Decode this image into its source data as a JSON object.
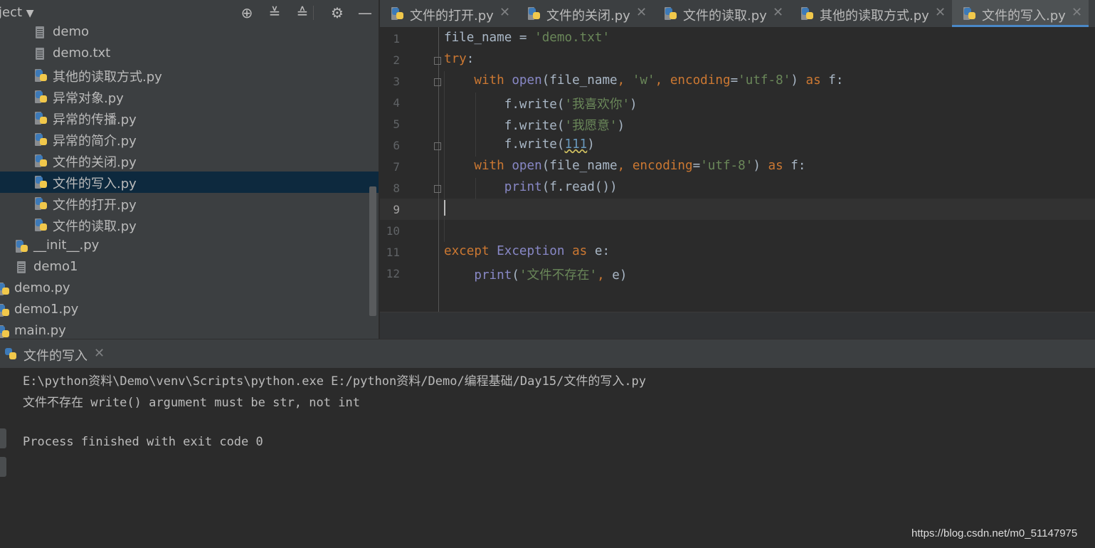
{
  "project_panel": {
    "title": "ject",
    "tree": [
      {
        "label": "demo",
        "icon": "text-file-icon"
      },
      {
        "label": "demo.txt",
        "icon": "text-file-icon"
      },
      {
        "label": "其他的读取方式.py",
        "icon": "python-file-icon"
      },
      {
        "label": "异常对象.py",
        "icon": "python-file-icon"
      },
      {
        "label": "异常的传播.py",
        "icon": "python-file-icon"
      },
      {
        "label": "异常的简介.py",
        "icon": "python-file-icon"
      },
      {
        "label": "文件的关闭.py",
        "icon": "python-file-icon"
      },
      {
        "label": "文件的写入.py",
        "icon": "python-file-icon",
        "selected": true
      },
      {
        "label": "文件的打开.py",
        "icon": "python-file-icon"
      },
      {
        "label": "文件的读取.py",
        "icon": "python-file-icon"
      },
      {
        "label": "__init__.py",
        "icon": "python-file-icon"
      },
      {
        "label": "demo1",
        "icon": "text-file-icon"
      },
      {
        "label": "demo.py",
        "icon": "python-file-icon"
      },
      {
        "label": "demo1.py",
        "icon": "python-file-icon"
      },
      {
        "label": "main.py",
        "icon": "python-file-icon"
      }
    ]
  },
  "tabs": [
    {
      "label": "文件的打开.py"
    },
    {
      "label": "文件的关闭.py"
    },
    {
      "label": "文件的读取.py"
    },
    {
      "label": "其他的读取方式.py"
    },
    {
      "label": "文件的写入.py",
      "active": true
    }
  ],
  "editor": {
    "line_numbers": [
      "1",
      "2",
      "3",
      "4",
      "5",
      "6",
      "7",
      "8",
      "9",
      "10",
      "11",
      "12"
    ],
    "lines": [
      "file_name = 'demo.txt'",
      "try:",
      "    with open(file_name, 'w', encoding='utf-8') as f:",
      "        f.write('我喜欢你')",
      "        f.write('我愿意')",
      "        f.write(111)",
      "    with open(file_name, encoding='utf-8') as f:",
      "        print(f.read())",
      "",
      "",
      "except Exception as e:",
      "    print('文件不存在', e)"
    ],
    "current_line": 9
  },
  "run_panel": {
    "title": "文件的写入",
    "output": [
      "E:\\python资料\\Demo\\venv\\Scripts\\python.exe E:/python资料/Demo/编程基础/Day15/文件的写入.py",
      "文件不存在 write() argument must be str, not int",
      "",
      "Process finished with exit code 0"
    ]
  },
  "watermark": "https://blog.csdn.net/m0_51147975",
  "colors": {
    "keyword": "#cc7832",
    "string": "#6a8759",
    "builtin": "#8888c6",
    "number": "#6897bb",
    "selection": "#0d293e",
    "tab_active_underline": "#4a88c7"
  }
}
